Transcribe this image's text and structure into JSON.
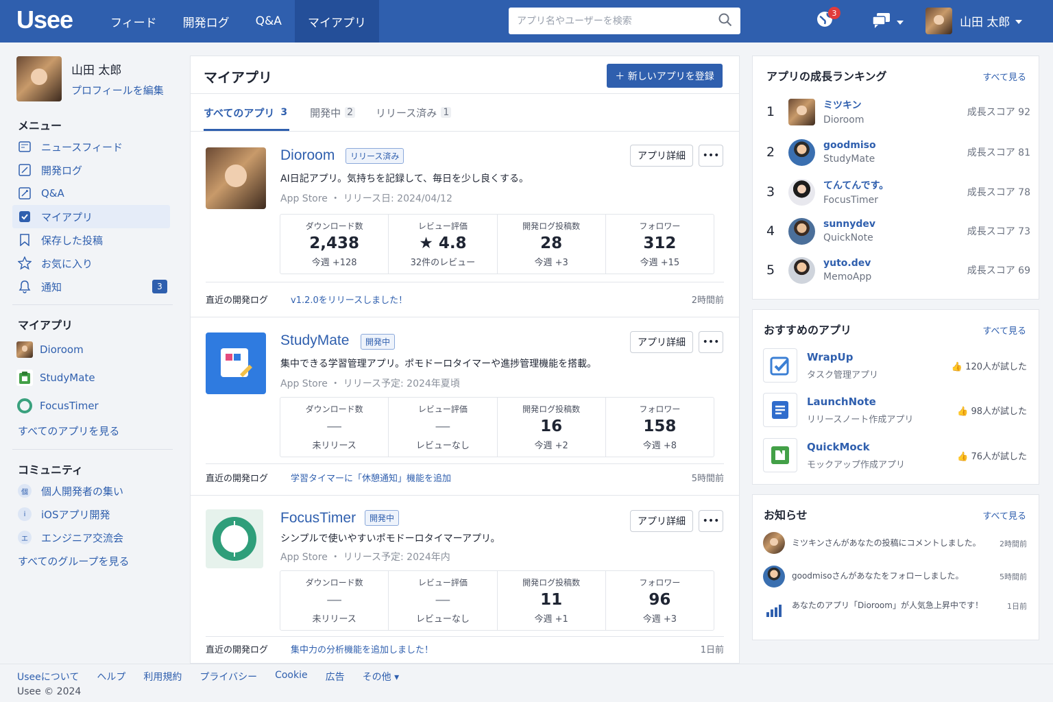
{
  "header": {
    "logo": "Usee",
    "nav": [
      "フィード",
      "開発ログ",
      "Q&A",
      "マイアプリ"
    ],
    "search_placeholder": "アプリ名やユーザーを検索",
    "notif_count": "3",
    "user_name": "山田 太郎"
  },
  "sidebar": {
    "profile_name": "山田 太郎",
    "profile_edit": "プロフィールを編集",
    "menu_heading": "メニュー",
    "menu": [
      {
        "label": "ニュースフィード",
        "icon": "newsfeed-icon"
      },
      {
        "label": "開発ログ",
        "icon": "devlog-icon"
      },
      {
        "label": "Q&A",
        "icon": "qa-icon"
      },
      {
        "label": "マイアプリ",
        "icon": "checkbox-icon"
      },
      {
        "label": "保存した投稿",
        "icon": "bookmark-icon"
      },
      {
        "label": "お気に入り",
        "icon": "star-icon"
      },
      {
        "label": "通知",
        "icon": "bell-icon"
      }
    ],
    "notif_badge": "3",
    "apps_heading": "マイアプリ",
    "apps": [
      "Dioroom",
      "StudyMate",
      "FocusTimer"
    ],
    "all_apps": "すべてのアプリを見る",
    "community_heading": "コミュニティ",
    "groups": [
      {
        "label": "個人開発者の集い",
        "icon": "個"
      },
      {
        "label": "iOSアプリ開発",
        "icon": "i"
      },
      {
        "label": "エンジニア交流会",
        "icon": "エ"
      }
    ],
    "all_groups": "すべてのグループを見る"
  },
  "main": {
    "title": "マイアプリ",
    "new_app": "＋ 新しいアプリを登録",
    "tabs": [
      {
        "label": "すべてのアプリ",
        "count": "3"
      },
      {
        "label": "開発中",
        "count": "2"
      },
      {
        "label": "リリース済み",
        "count": "1"
      }
    ],
    "detail_label": "アプリ詳細",
    "log_label": "直近の開発ログ",
    "stat_labels": [
      "ダウンロード数",
      "レビュー評価",
      "開発ログ投稿数",
      "フォロワー"
    ],
    "apps": [
      {
        "name": "Dioroom",
        "tag": "リリース済み",
        "desc": "AI日記アプリ。気持ちを記録して、毎日を少し良くする。",
        "meta": "App Store  ・  リリース日: 2024/04/12",
        "stats": [
          {
            "v": "2,438",
            "s": "今週 +128"
          },
          {
            "v": "★ 4.8",
            "s": "32件のレビュー"
          },
          {
            "v": "28",
            "s": "今週 +3"
          },
          {
            "v": "312",
            "s": "今週 +15"
          }
        ],
        "log": "v1.2.0をリリースしました！",
        "time": "2時間前"
      },
      {
        "name": "StudyMate",
        "tag": "開発中",
        "desc": "集中できる学習管理アプリ。ポモドーロタイマーや進捗管理機能を搭載。",
        "meta": "App Store  ・  リリース予定: 2024年夏頃",
        "stats": [
          {
            "v": "—",
            "s": "未リリース"
          },
          {
            "v": "—",
            "s": "レビューなし"
          },
          {
            "v": "16",
            "s": "今週 +2"
          },
          {
            "v": "158",
            "s": "今週 +8"
          }
        ],
        "log": "学習タイマーに「休憩通知」機能を追加",
        "time": "5時間前"
      },
      {
        "name": "FocusTimer",
        "tag": "開発中",
        "desc": "シンプルで使いやすいポモドーロタイマーアプリ。",
        "meta": "App Store  ・  リリース予定: 2024年内",
        "stats": [
          {
            "v": "—",
            "s": "未リリース"
          },
          {
            "v": "—",
            "s": "レビューなし"
          },
          {
            "v": "11",
            "s": "今週 +1"
          },
          {
            "v": "96",
            "s": "今週 +3"
          }
        ],
        "log": "集中力の分析機能を追加しました！",
        "time": "1日前"
      }
    ]
  },
  "ranking": {
    "title": "アプリの成長ランキング",
    "more": "すべて見る",
    "items": [
      {
        "n": "1",
        "user": "ミツキン",
        "app": "Dioroom",
        "score": "成長スコア 92"
      },
      {
        "n": "2",
        "user": "goodmiso",
        "app": "StudyMate",
        "score": "成長スコア 81"
      },
      {
        "n": "3",
        "user": "てんてんです。",
        "app": "FocusTimer",
        "score": "成長スコア 78"
      },
      {
        "n": "4",
        "user": "sunnydev",
        "app": "QuickNote",
        "score": "成長スコア 73"
      },
      {
        "n": "5",
        "user": "yuto.dev",
        "app": "MemoApp",
        "score": "成長スコア 69"
      }
    ]
  },
  "recommend": {
    "title": "おすすめのアプリ",
    "more": "すべて見る",
    "items": [
      {
        "name": "WrapUp",
        "sub": "タスク管理アプリ",
        "tried": "👍 120人が試した"
      },
      {
        "name": "LaunchNote",
        "sub": "リリースノート作成アプリ",
        "tried": "👍 98人が試した"
      },
      {
        "name": "QuickMock",
        "sub": "モックアップ作成アプリ",
        "tried": "👍 76人が試した"
      }
    ]
  },
  "notices": {
    "title": "お知らせ",
    "more": "すべて見る",
    "items": [
      {
        "text": "ミツキンさんがあなたの投稿にコメントしました。",
        "time": "2時間前"
      },
      {
        "text": "goodmisoさんがあなたをフォローしました。",
        "time": "5時間前"
      },
      {
        "text": "あなたのアプリ「Dioroom」が人気急上昇中です！",
        "time": "1日前"
      }
    ]
  },
  "footer": {
    "links": [
      "Useeについて",
      "ヘルプ",
      "利用規約",
      "プライバシー",
      "Cookie",
      "広告",
      "その他 ▾"
    ],
    "copy": "Usee © 2024"
  }
}
